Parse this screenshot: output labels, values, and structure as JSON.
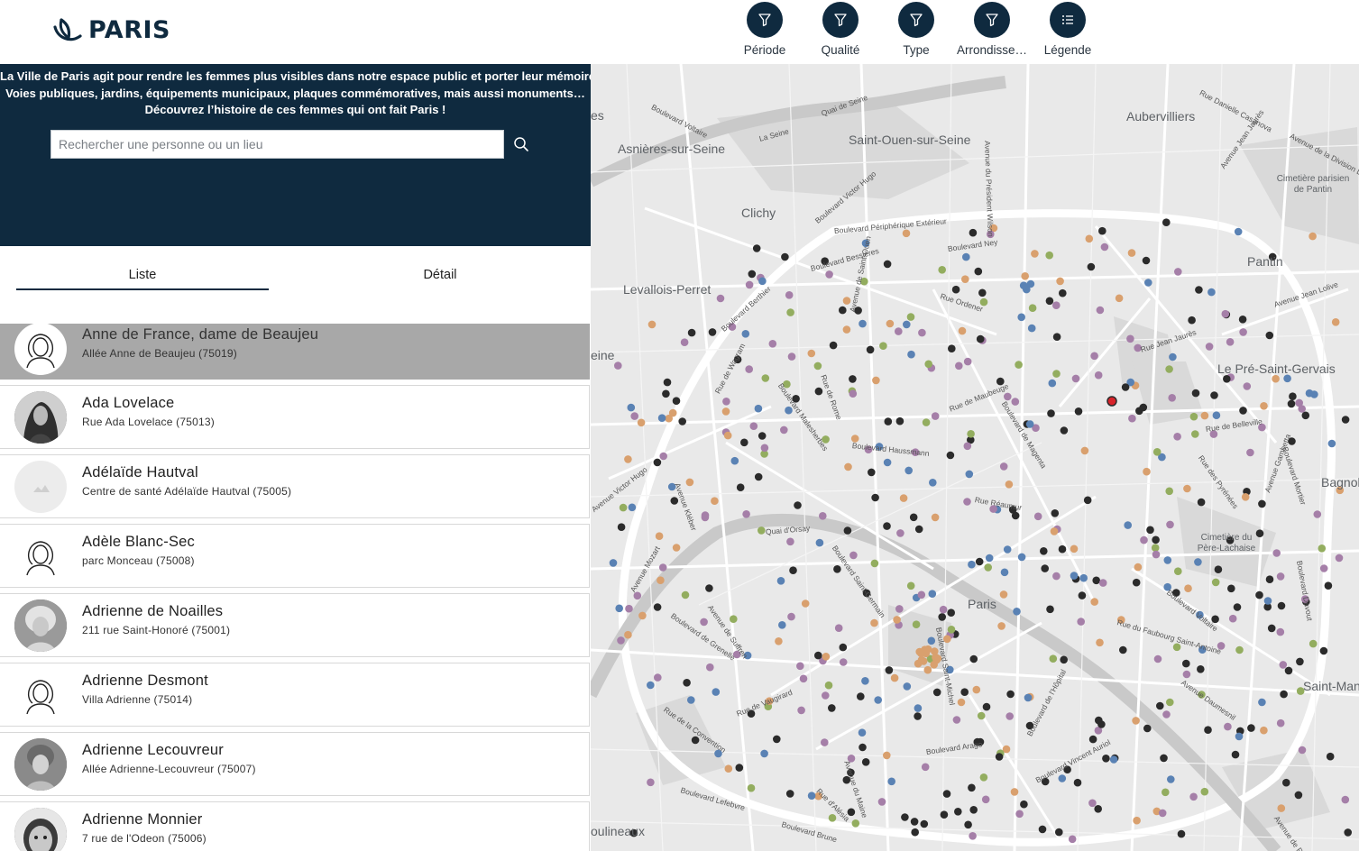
{
  "header": {
    "logo_text": "PARIS",
    "toolbar": [
      {
        "label": "Période",
        "icon": "filter-icon"
      },
      {
        "label": "Qualité",
        "icon": "filter-icon"
      },
      {
        "label": "Type",
        "icon": "filter-icon"
      },
      {
        "label": "Arrondisse…",
        "icon": "filter-icon"
      },
      {
        "label": "Légende",
        "icon": "list-icon"
      }
    ],
    "colors": {
      "navy": "#0f2a3f"
    }
  },
  "intro": {
    "line1": "La Ville de Paris agit pour rendre les femmes plus visibles dans notre espace public et porter leur mémoire.",
    "line2": "Voies publiques, jardins, équipements municipaux, plaques commémoratives, mais aussi monuments…",
    "line3": "Découvrez l’histoire de ces femmes qui ont fait Paris !",
    "search_placeholder": "Rechercher une personne ou un lieu",
    "search_value": ""
  },
  "tabs": {
    "liste": "Liste",
    "detail": "Détail",
    "active": "Liste"
  },
  "list": [
    {
      "name": "Anne de France, dame de Beaujeu",
      "address": "Allée Anne de Beaujeu (75019)",
      "avatar": "silhouette",
      "selected": true
    },
    {
      "name": "Ada Lovelace",
      "address": "Rue Ada Lovelace (75013)",
      "avatar": "photo"
    },
    {
      "name": "Adélaïde Hautval",
      "address": "Centre de santé Adélaïde Hautval (75005)",
      "avatar": "placeholder"
    },
    {
      "name": "Adèle Blanc-Sec",
      "address": "parc Monceau (75008)",
      "avatar": "silhouette"
    },
    {
      "name": "Adrienne de Noailles",
      "address": "211 rue Saint-Honoré (75001)",
      "avatar": "photo"
    },
    {
      "name": "Adrienne Desmont",
      "address": "Villa Adrienne (75014)",
      "avatar": "silhouette"
    },
    {
      "name": "Adrienne Lecouvreur",
      "address": "Allée Adrienne-Lecouvreur (75007)",
      "avatar": "photo"
    },
    {
      "name": "Adrienne Monnier",
      "address": "7 rue de l'Odeon (75006)",
      "avatar": "photo"
    }
  ],
  "map": {
    "places": [
      "Aubervilliers",
      "Saint-Ouen-sur-Seine",
      "Asnières-sur-Seine",
      "Clichy",
      "Pantin",
      "Levallois-Perret",
      "Le Pré-Saint-Gervais",
      "Bagnol",
      "Paris",
      "Saint-Man",
      "oulineaux",
      "eine",
      "es",
      "Cimetière parisien de Pantin",
      "Cimetière du Père-Lachaise"
    ],
    "streets": [
      "Boulevard Voltaire",
      "Quai de Seine",
      "La Seine",
      "Boulevard Victor Hugo",
      "Boulevard Périphérique Extérieur",
      "Boulevard Bessières",
      "Boulevard Ney",
      "Rue Ordener",
      "Boulevard Berthier",
      "Rue Jean Jaurès",
      "Avenue Jean Lolive",
      "Boulevard Haussmann",
      "Rue Réaumur",
      "Boulevard Malesherbes",
      "Avenue Victor Hugo",
      "Quai d'Orsay",
      "Boulevard Saint-Germain",
      "Avenue de Suffren",
      "Boulevard de Grenelle",
      "Rue de Vaugirard",
      "Rue de la Convention",
      "Boulevard Lefebvre",
      "Boulevard Brune",
      "Boulevard Arago",
      "Boulevard Vincent Auriol",
      "Rue du Faubourg Saint-Antoine",
      "Boulevard Voltaire",
      "Rue de Belleville",
      "Avenue Gambetta",
      "Boulevard Mortier",
      "Rue des Pyrénées",
      "Rue de Wagram",
      "Avenue Kléber",
      "Rue de Maubeuge",
      "Boulevard de Magenta",
      "Rue de Rome",
      "Avenue de Saint-Ouen",
      "Avenue du Président Wilson",
      "Rue Danielle Casanova",
      "Avenue Jean Jaurès",
      "Avenue de la Division Leclerc",
      "Boulevard de l'Hôpital",
      "Avenue du Maine",
      "Rue d'Alésia",
      "Avenue de Paris",
      "Boulevard Saint-Michel",
      "Avenue Daumesnil",
      "Boulevard Davout",
      "Avenue Mozart"
    ],
    "marker_colors": {
      "black": "#2b2b2b",
      "purple": "#a57fa8",
      "green": "#93ad5f",
      "blue": "#5a82b4",
      "orange": "#d9a06e",
      "selected": "#d8232a"
    }
  }
}
